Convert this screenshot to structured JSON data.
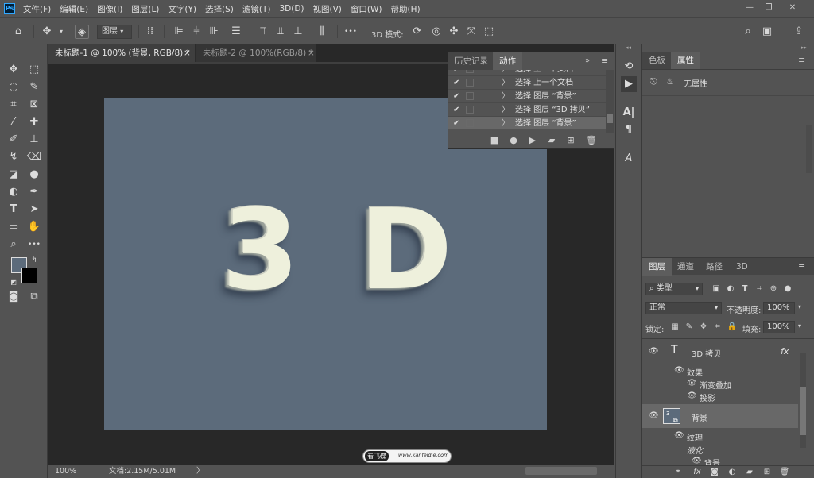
{
  "app": {
    "logo": "Ps"
  },
  "menu": [
    "文件(F)",
    "编辑(E)",
    "图像(I)",
    "图层(L)",
    "文字(Y)",
    "选择(S)",
    "滤镜(T)",
    "3D(D)",
    "视图(V)",
    "窗口(W)",
    "帮助(H)"
  ],
  "window_controls": {
    "minimize": "—",
    "restore": "❐",
    "close": "✕"
  },
  "options_bar": {
    "layer_select": "图层",
    "mode_3d_label": "3D 模式:",
    "more": "•••"
  },
  "doc_tabs": [
    {
      "title": "未标题-1 @ 100% (背景, RGB/8) *",
      "close": "×"
    },
    {
      "title": "未标题-2 @ 100%(RGB/8) *",
      "close": "×"
    }
  ],
  "canvas_text": {
    "left": "3",
    "right": "D",
    "canvas_color": "#5c6b7b"
  },
  "status": {
    "zoom": "100%",
    "doc_info": "文档:2.15M/5.01M",
    "arrow": "〉"
  },
  "actions_panel": {
    "tabs": [
      "历史记录",
      "动作"
    ],
    "active_tab": "动作",
    "rows": [
      {
        "check": "✔",
        "text": "选择 上一个文档"
      },
      {
        "check": "✔",
        "text": "选择 上一个文档"
      },
      {
        "check": "✔",
        "text": "选择 图层 “背景”"
      },
      {
        "check": "✔",
        "text": "选择 图层 “3D 拷贝”"
      },
      {
        "check": "✔",
        "text": "选择 图层 “背景”"
      }
    ]
  },
  "properties_panel": {
    "tabs": [
      "色板",
      "属性"
    ],
    "active_tab": "属性",
    "empty_text": "无属性"
  },
  "layers_panel": {
    "tabs": [
      "图层",
      "通道",
      "路径",
      "3D"
    ],
    "active_tab": "图层",
    "filter_label": "类型",
    "blend_mode": "正常",
    "opacity_label": "不透明度:",
    "opacity_value": "100%",
    "lock_label": "锁定:",
    "fill_label": "填充:",
    "fill_value": "100%",
    "layers": [
      {
        "name": "3D 拷贝",
        "kind": "text",
        "effects_label": "效果",
        "effects": [
          "渐变叠加",
          "投影"
        ]
      },
      {
        "name": "背景",
        "kind": "smart",
        "effects_label": "纹理",
        "sub_label": "液化",
        "sub_items": [
          "背景"
        ]
      }
    ],
    "footer_icons": [
      "link-icon",
      "fx-icon",
      "mask-icon",
      "adjustment-icon",
      "folder-icon",
      "new-layer-icon",
      "trash-icon"
    ]
  },
  "watermark": {
    "logo": "看飞碟",
    "url": "www.kanfeidie.com"
  }
}
